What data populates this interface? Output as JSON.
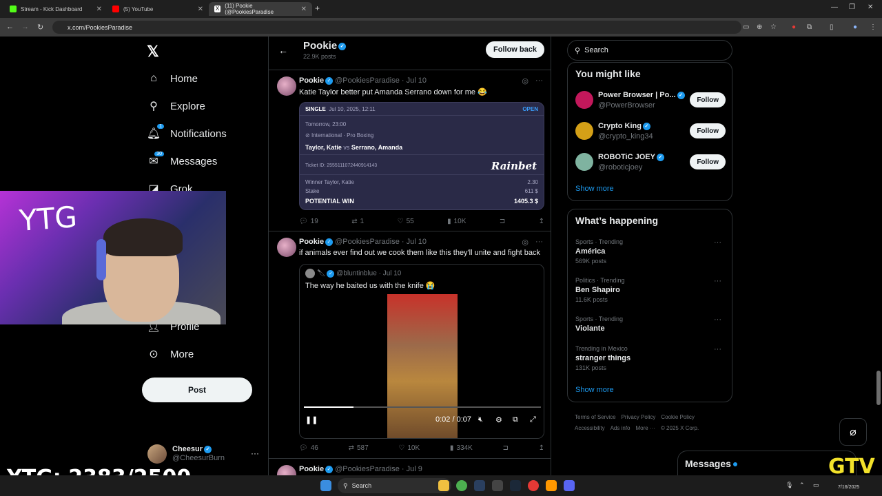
{
  "browser": {
    "tabs": [
      {
        "title": "Stream - Kick Dashboard",
        "color": "#53fc18"
      },
      {
        "title": "(5) YouTube",
        "color": "#ff0000"
      },
      {
        "title": "(11) Pookie (@PookiesParadise",
        "color": "#ffffff"
      }
    ],
    "url": "x.com/PookiesParadise"
  },
  "nav": {
    "items": [
      {
        "label": "Home",
        "icon": "home-icon"
      },
      {
        "label": "Explore",
        "icon": "search-icon"
      },
      {
        "label": "Notifications",
        "icon": "bell-icon",
        "badge": "1"
      },
      {
        "label": "Messages",
        "icon": "mail-icon",
        "badge": "30"
      },
      {
        "label": "Grok",
        "icon": "grok-icon"
      },
      {
        "label": "Profile",
        "icon": "person-icon"
      },
      {
        "label": "More",
        "icon": "more-circle-icon"
      }
    ],
    "post_label": "Post",
    "me": {
      "name": "Cheesur",
      "handle": "@CheesurBurn"
    }
  },
  "webcam": {
    "overlay_text": "YTG"
  },
  "profile_header": {
    "name": "Pookie",
    "posts": "22.9K posts",
    "follow_back": "Follow back"
  },
  "tweets": [
    {
      "name": "Pookie",
      "handle": "@PookiesParadise",
      "date": "Jul 10",
      "text": "Katie Taylor better put Amanda Serrano down for me 😂",
      "slip": {
        "type": "SINGLE",
        "datetime": "Jul 10, 2025, 12:11",
        "status": "OPEN",
        "time": "Tomorrow, 23:00",
        "league": "International · Pro Boxing",
        "match_a": "Taylor, Katie",
        "vs": "vs",
        "match_b": "Serrano, Amanda",
        "ticket": "Ticket ID: 2555111072440914143",
        "brand": "Rainbet",
        "selection": "Winner Taylor, Katie",
        "odds": "2.30",
        "stake_label": "Stake",
        "stake": "611 $",
        "win_label": "POTENTIAL WIN",
        "win": "1405.3 $"
      },
      "stats": {
        "replies": "19",
        "reposts": "1",
        "likes": "55",
        "views": "10K"
      }
    },
    {
      "name": "Pookie",
      "handle": "@PookiesParadise",
      "date": "Jul 10",
      "text": "if animals ever find out we cook them like this they'll unite and fight back",
      "quote": {
        "handle": "@bluntinblue",
        "date": "Jul 10",
        "text": "The way he baited us with the knife 😭"
      },
      "video": {
        "time": "0:02 / 0:07",
        "progress": 0.21
      },
      "stats": {
        "replies": "46",
        "reposts": "587",
        "likes": "10K",
        "views": "334K"
      }
    },
    {
      "name": "Pookie",
      "handle": "@PookiesParadise",
      "date": "Jul 9"
    }
  ],
  "search": {
    "placeholder": "Search"
  },
  "you_might_like": {
    "title": "You might like",
    "accounts": [
      {
        "name": "Power Browser | Po...",
        "handle": "@PowerBrowser",
        "follow": "Follow",
        "color": "#c2185b"
      },
      {
        "name": "Crypto King",
        "handle": "@crypto_king34",
        "follow": "Follow",
        "color": "#d4a017"
      },
      {
        "name": "ROBOTiC JOEY",
        "handle": "@roboticjoey",
        "follow": "Follow",
        "color": "#7fb3a0"
      }
    ],
    "show_more": "Show more"
  },
  "whats_happening": {
    "title": "What’s happening",
    "trends": [
      {
        "context": "Sports · Trending",
        "topic": "América",
        "posts": "569K posts"
      },
      {
        "context": "Politics · Trending",
        "topic": "Ben Shapiro",
        "posts": "11.6K posts"
      },
      {
        "context": "Sports · Trending",
        "topic": "Violante",
        "posts": ""
      },
      {
        "context": "Trending in Mexico",
        "topic": "stranger things",
        "posts": "131K posts"
      }
    ],
    "show_more": "Show more"
  },
  "footer": {
    "links": [
      "Terms of Service",
      "Privacy Policy",
      "Cookie Policy",
      "Accessibility",
      "Ads info",
      "More ···",
      "© 2025 X Corp."
    ]
  },
  "messages_drawer": {
    "label": "Messages"
  },
  "stream_overlay": {
    "score": "YTG: 2383/2500",
    "logo": "GTV"
  },
  "taskbar": {
    "search": "Search",
    "date": "7/16/2025"
  }
}
